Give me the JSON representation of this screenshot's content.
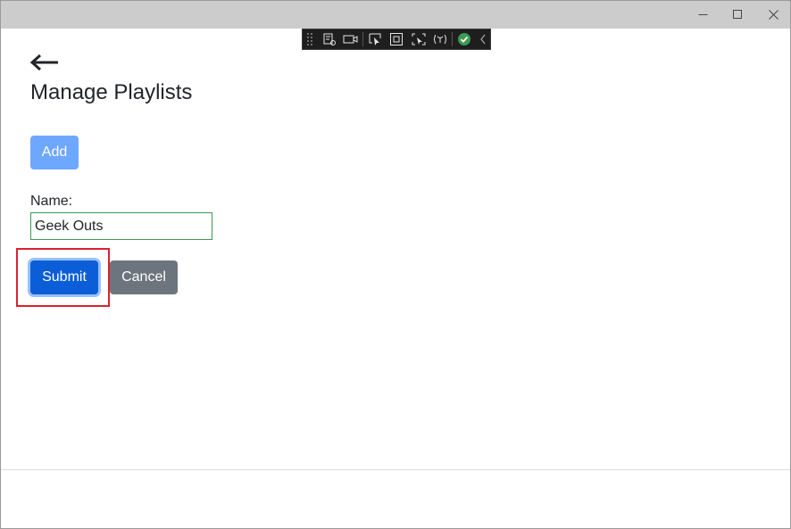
{
  "window": {
    "controls": {
      "minimize_icon": "minimize-icon",
      "maximize_icon": "maximize-icon",
      "close_icon": "close-icon"
    }
  },
  "debug_toolbar": {
    "icons": [
      "live-visual-tree-icon",
      "record-icon",
      "select-element-icon",
      "display-layout-adorners-icon",
      "track-focus-icon",
      "accessibility-icon",
      "hot-reload-status-icon",
      "collapse-toolbar-icon"
    ]
  },
  "page": {
    "back_icon": "back-arrow-icon",
    "title": "Manage Playlists",
    "add_label": "Add",
    "name_label": "Name:",
    "name_value": "Geek Outs",
    "submit_label": "Submit",
    "cancel_label": "Cancel"
  },
  "colors": {
    "add_button": "#6ea8fe",
    "submit_button": "#0b5ed7",
    "cancel_button": "#6c757d",
    "input_border_valid": "#3c9a52",
    "highlight_box": "#d9232e"
  }
}
